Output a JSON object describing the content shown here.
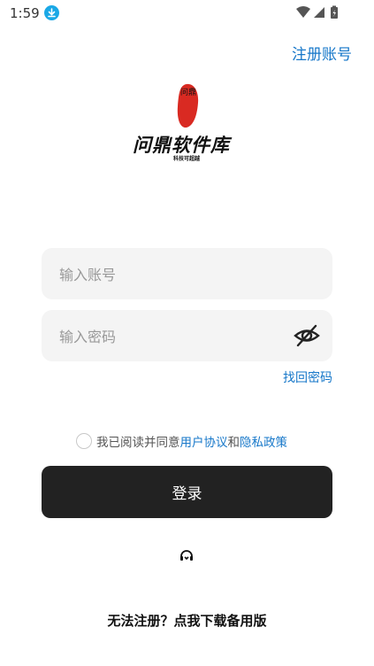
{
  "status_bar": {
    "time": "1:59"
  },
  "header": {
    "register_label": "注册账号"
  },
  "logo": {
    "title": "问鼎软件库",
    "subtitle": "科技可超越",
    "seal_text": "问鼎"
  },
  "form": {
    "account_placeholder": "输入账号",
    "password_placeholder": "输入密码",
    "forgot_label": "找回密码"
  },
  "agreement": {
    "prefix": "我已阅读并同意",
    "user_agreement": "用户协议",
    "and": "和",
    "privacy_policy": "隐私政策"
  },
  "login_label": "登录",
  "footer": {
    "download_backup_label": "无法注册？点我下载备用版"
  }
}
